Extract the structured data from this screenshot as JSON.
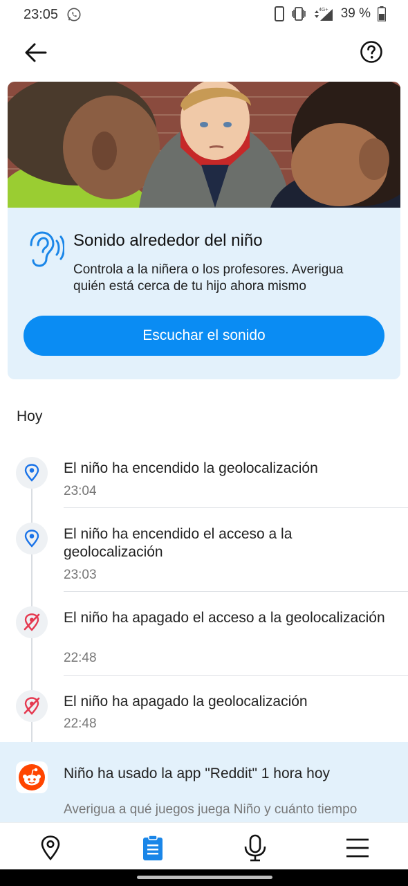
{
  "status_bar": {
    "time": "23:05",
    "battery": "39 %",
    "icons": [
      "whatsapp-icon",
      "vibrate-icon",
      "signal-4g-icon",
      "battery-icon"
    ]
  },
  "app_bar": {
    "back_icon": "arrow-left-icon",
    "help_icon": "question-circle-icon"
  },
  "sound_card": {
    "title": "Sonido alrededor del niño",
    "description": "Controla a la niñera o los profesores. Averigua quién está cerca de tu hijo ahora mismo",
    "button_label": "Escuchar el sonido",
    "accent_color": "#0a8cf3",
    "background_color": "#e3f1fb"
  },
  "feed": {
    "day_label": "Hoy",
    "events": [
      {
        "title": "El niño ha encendido la geolocalización",
        "time": "23:04",
        "icon": "location-pin-icon",
        "color": "#1a73e8"
      },
      {
        "title": "El niño ha encendido el acceso a la geolocalización",
        "time": "23:03",
        "icon": "location-pin-icon",
        "color": "#1a73e8"
      },
      {
        "title": "El niño ha apagado el acceso a la geolocalización",
        "time": "22:48",
        "icon": "location-off-icon",
        "color": "#e53950"
      },
      {
        "title": "El niño ha apagado la geolocalización",
        "time": "22:48",
        "icon": "location-off-icon",
        "color": "#e53950"
      }
    ],
    "app_usage": {
      "title": "Niño ha usado la app \"Reddit\" 1 hora hoy",
      "description": "Averigua a qué juegos juega Niño y cuánto tiempo",
      "icon": "reddit-icon"
    }
  },
  "bottom_nav": {
    "items": [
      {
        "name": "map",
        "icon": "location-pin-icon",
        "active": false
      },
      {
        "name": "events",
        "icon": "clipboard-icon",
        "active": true
      },
      {
        "name": "sound",
        "icon": "microphone-icon",
        "active": false
      },
      {
        "name": "menu",
        "icon": "hamburger-menu-icon",
        "active": false
      }
    ],
    "active_color": "#1a86e8"
  }
}
